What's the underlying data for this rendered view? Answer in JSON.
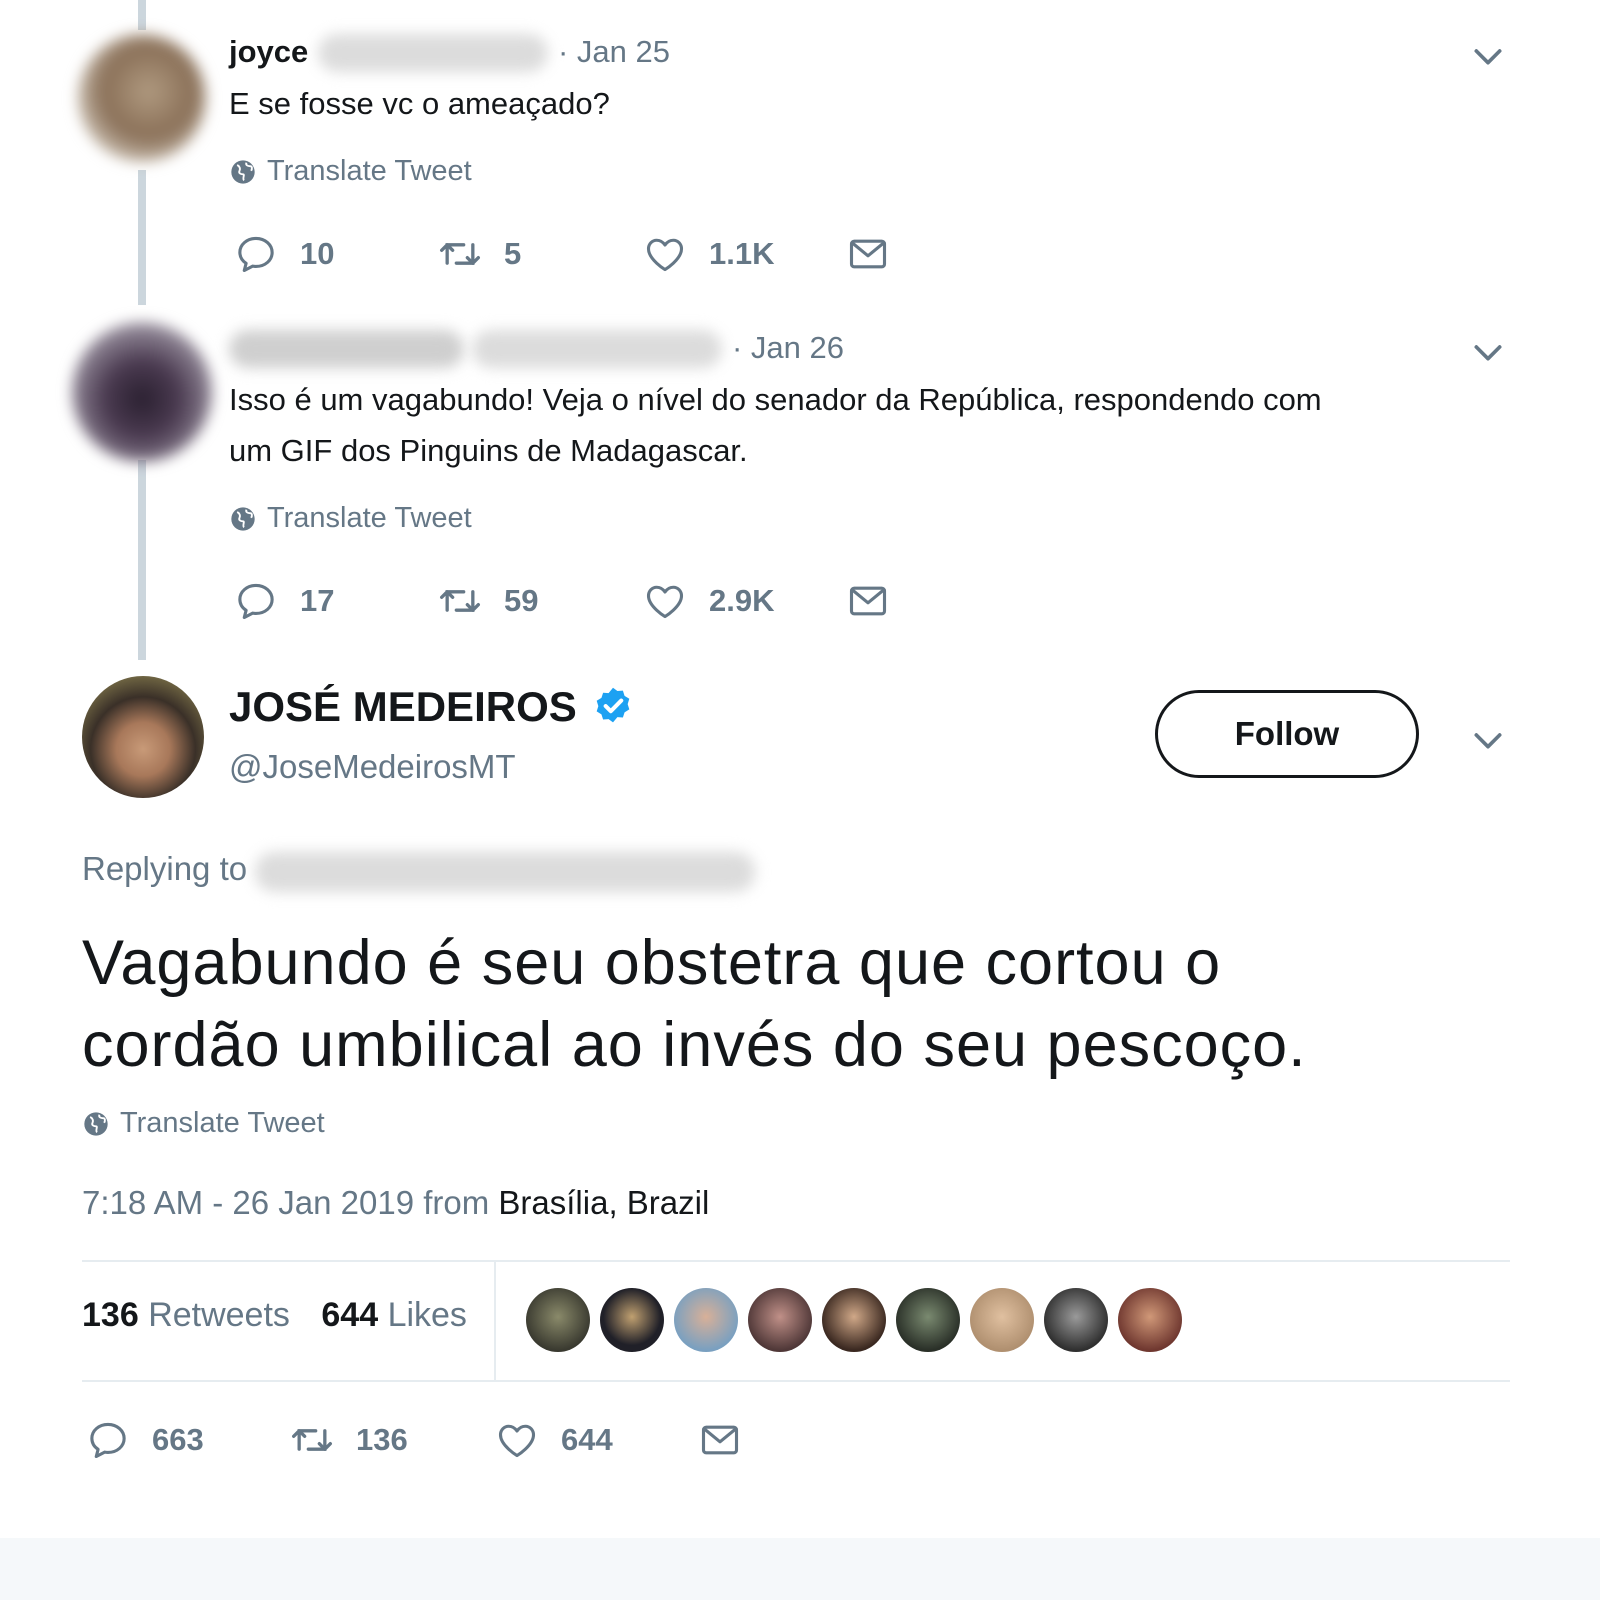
{
  "reply1": {
    "name": "joyce",
    "date": "· Jan 25",
    "text": "E se fosse vc o ameaçado?",
    "translate": "Translate Tweet",
    "replies": "10",
    "retweets": "5",
    "likes": "1.1K"
  },
  "reply2": {
    "date": "· Jan 26",
    "text_line1": "Isso é um vagabundo! Veja o nível do senador da República, respondendo com",
    "text_line2": "um GIF dos Pinguins de Madagascar.",
    "translate": "Translate Tweet",
    "replies": "17",
    "retweets": "59",
    "likes": "2.9K"
  },
  "main": {
    "name": "JOSÉ MEDEIROS",
    "handle": "@JoseMedeirosMT",
    "follow_label": "Follow",
    "replying_to": "Replying to",
    "text_line1": "Vagabundo é seu obstetra que cortou o",
    "text_line2": "cordão umbilical ao invés do seu pescoço.",
    "translate": "Translate Tweet",
    "timestamp": "7:18 AM - 26 Jan 2019 from",
    "location": "Brasília, Brazil",
    "retweets_count": "136",
    "retweets_label": "Retweets",
    "likes_count": "644",
    "likes_label": "Likes",
    "replies": "663",
    "retweets": "136",
    "likes": "644"
  },
  "colors": {
    "verified": "#1da1f2",
    "muted": "#657786",
    "text": "#14171a",
    "thread_line": "#ccd6dd"
  },
  "icons": [
    "reply-icon",
    "retweet-icon",
    "like-icon",
    "dm-icon",
    "globe-icon",
    "chevron-down-icon",
    "verified-badge-icon"
  ]
}
